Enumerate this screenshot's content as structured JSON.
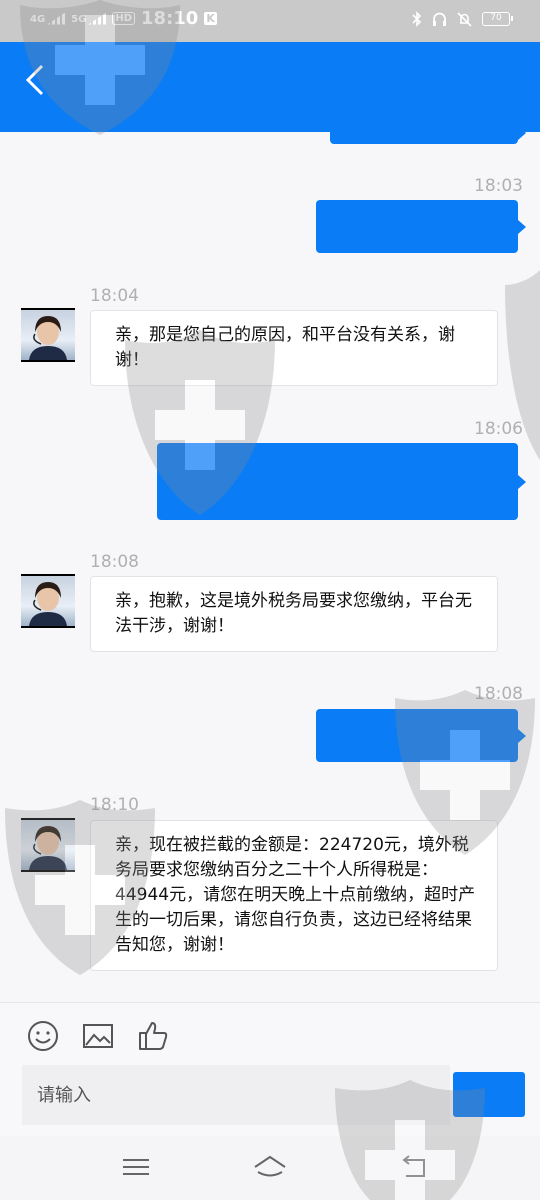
{
  "status_bar": {
    "signal1": "4G",
    "signal2": "5G",
    "hd_badge": "HD",
    "time": "18:10",
    "k_badge": "K",
    "battery": "70"
  },
  "chat": {
    "messages": [
      {
        "time": "18:03",
        "side": "right",
        "text": ""
      },
      {
        "time": "18:04",
        "side": "left",
        "text": "亲，那是您自己的原因，和平台没有关系，谢谢！"
      },
      {
        "time": "18:06",
        "side": "right",
        "text": ""
      },
      {
        "time": "18:08",
        "side": "left",
        "text": "亲，抱歉，这是境外税务局要求您缴纳，平台无法干涉，谢谢！"
      },
      {
        "time": "18:08",
        "side": "right",
        "text": ""
      },
      {
        "time": "18:10",
        "side": "left",
        "text": "亲，现在被拦截的金额是：224720元，境外税务局要求您缴纳百分之二十个人所得税是：44944元，请您在明天晚上十点前缴纳，超时产生的一切后果，请您自行负责，这边已经将结果告知您，谢谢！"
      }
    ]
  },
  "input": {
    "placeholder": "请输入",
    "send_label": ""
  },
  "colors": {
    "accent": "#0a7cf6",
    "status_bar": "#c9c9c9"
  },
  "icons": [
    "back-arrow-icon",
    "emoji-icon",
    "image-icon",
    "thumbs-up-icon",
    "menu-icon",
    "home-icon",
    "back-icon"
  ]
}
